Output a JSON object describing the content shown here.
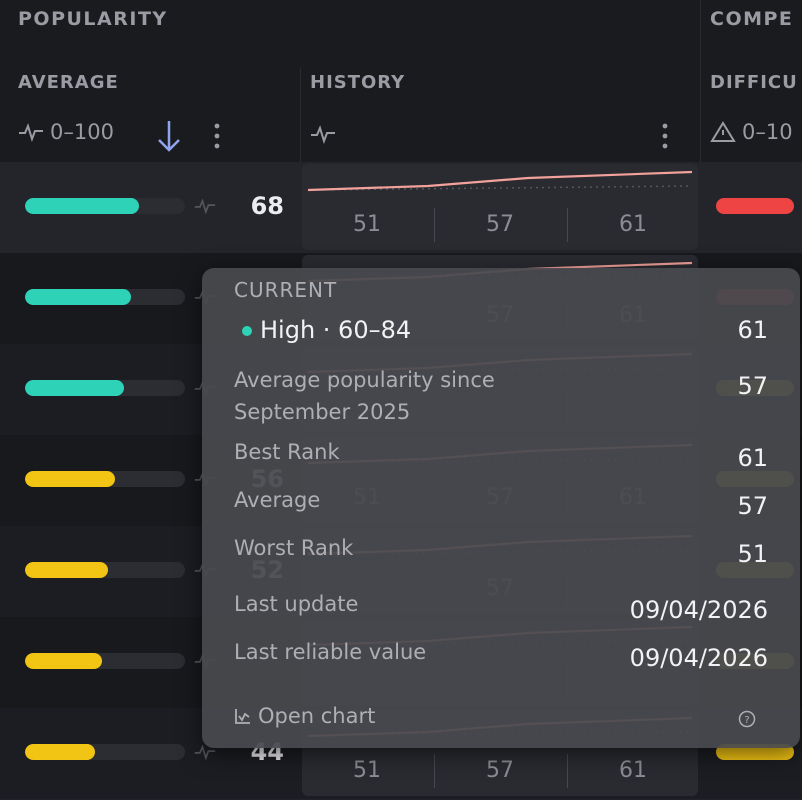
{
  "header": {
    "popularity": "POPULARITY",
    "competition": "COMPE",
    "average": "AVERAGE",
    "history": "HISTORY",
    "difficulty": "DIFFICU",
    "average_range": "0–100",
    "difficulty_range": "0–10"
  },
  "colors": {
    "teal": "#2ed3b7",
    "yellow": "#f2c413",
    "red": "#ef4444",
    "trend": "#f3a19b"
  },
  "rows": [
    {
      "fill": 0.71,
      "color": "#2ed3b7",
      "score": "68",
      "history": [
        "51",
        "57",
        "61"
      ],
      "diff_color": "#ef4444"
    },
    {
      "fill": 0.66,
      "color": "#2ed3b7",
      "score": "",
      "history": [
        "",
        "57",
        "61"
      ],
      "diff_color": "#b84a45"
    },
    {
      "fill": 0.62,
      "color": "#2ed3b7",
      "score": "",
      "history": [
        "",
        "",
        ""
      ],
      "diff_color": "#b8b23a"
    },
    {
      "fill": 0.56,
      "color": "#f2c413",
      "score": "56",
      "history": [
        "51",
        "57",
        "61"
      ],
      "diff_color": "#b8b23a"
    },
    {
      "fill": 0.52,
      "color": "#f2c413",
      "score": "52",
      "history": [
        "",
        "57",
        ""
      ],
      "diff_color": "#b8b23a"
    },
    {
      "fill": 0.48,
      "color": "#f2c413",
      "score": "",
      "history": [
        "",
        "",
        ""
      ],
      "diff_color": "#b8b23a"
    },
    {
      "fill": 0.44,
      "color": "#f2c413",
      "score": "44",
      "history": [
        "51",
        "57",
        "61"
      ],
      "diff_color": "#f2c413"
    }
  ],
  "tooltip": {
    "title": "CURRENT",
    "current_level": "High · 60–84",
    "current_value": "61",
    "avg_since_line1": "Average popularity since",
    "avg_since_line2": "September 2025",
    "avg_since_value": "57",
    "best_rank_label": "Best Rank",
    "best_rank_value": "61",
    "average_label": "Average",
    "average_value": "57",
    "worst_rank_label": "Worst Rank",
    "worst_rank_value": "51",
    "last_update_label": "Last update",
    "last_update_value": "09/04/2026",
    "last_reliable_label": "Last reliable value",
    "last_reliable_value": "09/04/2026",
    "open_chart": "Open chart"
  }
}
